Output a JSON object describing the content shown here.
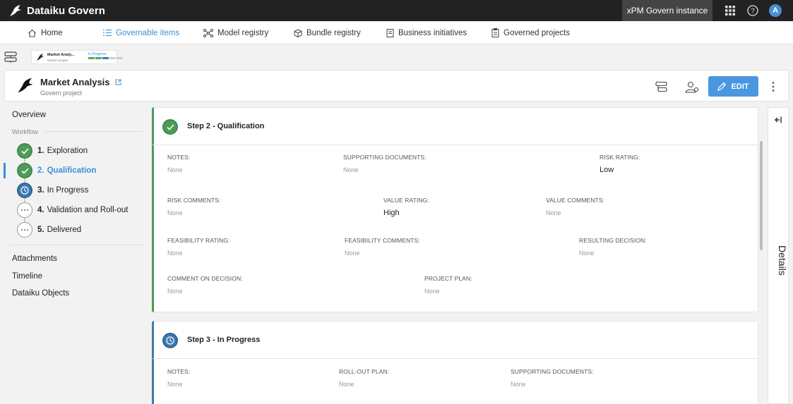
{
  "app": {
    "brand": "Dataiku Govern",
    "instance": "xPM Govern instance",
    "avatar_letter": "A"
  },
  "nav": {
    "home": "Home",
    "governable": "Governable items",
    "model_registry": "Model registry",
    "bundle_registry": "Bundle registry",
    "business_initiatives": "Business initiatives",
    "governed_projects": "Governed projects"
  },
  "thumb": {
    "title": "Market Analy...",
    "subtitle": "Govern project",
    "status": "In Progress"
  },
  "header": {
    "title": "Market Analysis",
    "subtitle": "Govern project",
    "edit_label": "EDIT"
  },
  "sidebar": {
    "overview": "Overview",
    "workflow": "Workflow",
    "steps": [
      {
        "num": "1.",
        "label": "Exploration",
        "state": "done"
      },
      {
        "num": "2.",
        "label": "Qualification",
        "state": "done"
      },
      {
        "num": "3.",
        "label": "In Progress",
        "state": "current"
      },
      {
        "num": "4.",
        "label": "Validation and Roll-out",
        "state": "pending"
      },
      {
        "num": "5.",
        "label": "Delivered",
        "state": "pending"
      }
    ],
    "attachments": "Attachments",
    "timeline": "Timeline",
    "objects": "Dataiku Objects"
  },
  "step2": {
    "title": "Step 2 - Qualification",
    "fields": {
      "notes": {
        "label": "NOTES:",
        "value": "None"
      },
      "supporting": {
        "label": "SUPPORTING DOCUMENTS:",
        "value": "None"
      },
      "risk_rating": {
        "label": "RISK RATING:",
        "value": "Low"
      },
      "risk_comments": {
        "label": "RISK COMMENTS:",
        "value": "None"
      },
      "value_rating": {
        "label": "VALUE RATING:",
        "value": "High"
      },
      "value_comments": {
        "label": "VALUE COMMENTS:",
        "value": "None"
      },
      "feas_rating": {
        "label": "FEASIBILITY RATING:",
        "value": "None"
      },
      "feas_comments": {
        "label": "FEASIBILITY COMMENTS:",
        "value": "None"
      },
      "decision": {
        "label": "RESULTING DECISION:",
        "value": "None"
      },
      "comment_decision": {
        "label": "COMMENT ON DECISION:",
        "value": "None"
      },
      "project_plan": {
        "label": "PROJECT PLAN:",
        "value": "None"
      }
    }
  },
  "step3": {
    "title": "Step 3 - In Progress",
    "fields": {
      "notes": {
        "label": "NOTES:",
        "value": "None"
      },
      "rollout": {
        "label": "ROLL-OUT PLAN:",
        "value": "None"
      },
      "supporting": {
        "label": "SUPPORTING DOCUMENTS:",
        "value": "None"
      }
    }
  },
  "details": {
    "label": "Details"
  },
  "colors": {
    "accent": "#3b8fd9",
    "done": "#4d9c57",
    "current": "#3d7ab0",
    "edit": "#4a97e0"
  }
}
